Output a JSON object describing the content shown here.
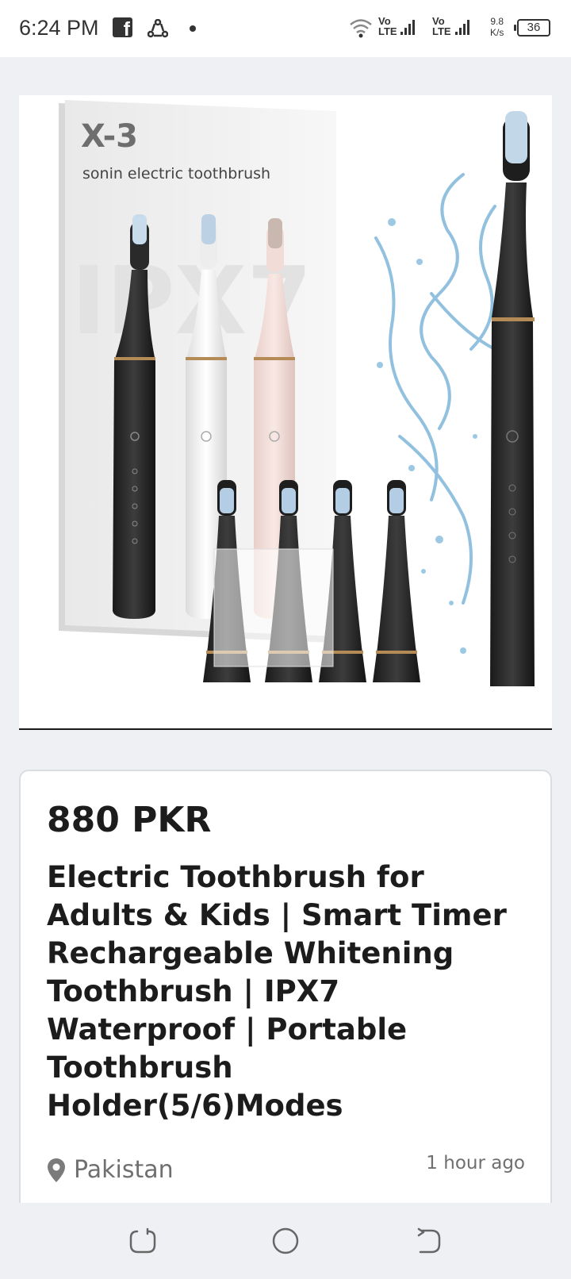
{
  "status_bar": {
    "time": "6:24 PM",
    "network1_vo": "Vo",
    "network1_lte": "LTE",
    "network2_vo": "Vo",
    "network2_lte": "LTE",
    "speed_value": "9.8",
    "speed_unit": "K/s",
    "battery": "36"
  },
  "product_image": {
    "box_model": "X-3",
    "box_subtitle": "sonin electric toothbrush",
    "box_watermark": "IPX7"
  },
  "listing": {
    "price": "880 PKR",
    "title": "Electric Toothbrush for Adults & Kids | Smart Timer Rechargeable Whitening Toothbrush | IPX7 Waterproof | Portable Toothbrush Holder(5/6)Modes",
    "location": "Pakistan",
    "posted": "1 hour ago"
  },
  "icons": {
    "facebook": "facebook-icon",
    "sync": "sync-icon",
    "wifi": "wifi-icon",
    "location": "location-pin-icon",
    "recent": "recent-apps-icon",
    "home": "home-icon",
    "back": "back-icon"
  }
}
